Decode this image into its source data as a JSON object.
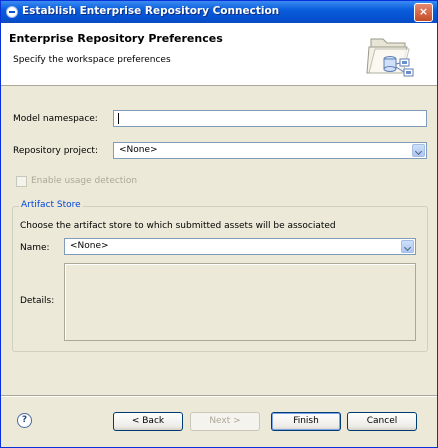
{
  "window": {
    "title": "Establish Enterprise Repository Connection",
    "close_label": "×"
  },
  "banner": {
    "title": "Enterprise Repository Preferences",
    "subtitle": "Specify the workspace preferences",
    "icon": "wizard-folder-icon"
  },
  "form": {
    "model_namespace": {
      "label": "Model namespace:",
      "value": "",
      "placeholder": ""
    },
    "repository_project": {
      "label": "Repository project:",
      "value": "<None>"
    },
    "usage_detection": {
      "label": "Enable usage detection",
      "checked": false,
      "enabled": false
    }
  },
  "artifact_store": {
    "group_label": "Artifact Store",
    "description": "Choose the artifact store to which submitted assets will be associated",
    "name_label": "Name:",
    "name_value": "<None>",
    "details_label": "Details:"
  },
  "buttons": {
    "help": "?",
    "back": "< Back",
    "next": "Next >",
    "finish": "Finish",
    "cancel": "Cancel"
  },
  "colors": {
    "titlebar": "#0550d0",
    "group_legend": "#0046d5",
    "dialog_bg": "#ece9d8"
  }
}
